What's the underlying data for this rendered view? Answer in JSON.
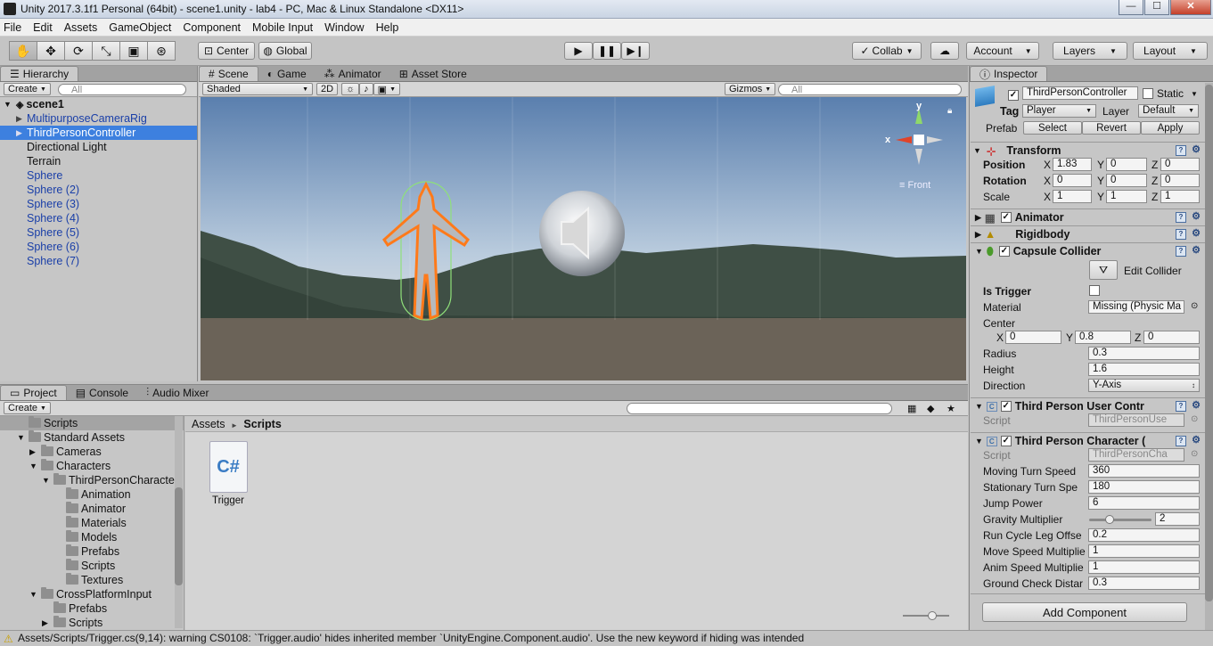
{
  "window": {
    "title": "Unity 2017.3.1f1 Personal (64bit) - scene1.unity - lab4 - PC, Mac & Linux Standalone <DX11>",
    "btn_min": "—",
    "btn_max": "☐",
    "btn_close": "✕"
  },
  "menu": [
    "File",
    "Edit",
    "Assets",
    "GameObject",
    "Component",
    "Mobile Input",
    "Window",
    "Help"
  ],
  "toolbar": {
    "center": "Center",
    "global": "Global",
    "collab": "Collab",
    "account": "Account",
    "layers": "Layers",
    "layout": "Layout"
  },
  "hierarchy": {
    "tab": "Hierarchy",
    "create": "Create",
    "search_placeholder": "All",
    "scene": "scene1",
    "items": [
      "MultipurposeCameraRig",
      "ThirdPersonController",
      "Directional Light",
      "Terrain",
      "Sphere",
      "Sphere (2)",
      "Sphere (3)",
      "Sphere (4)",
      "Sphere (5)",
      "Sphere (6)",
      "Sphere (7)"
    ]
  },
  "scene_view": {
    "tabs": [
      "Scene",
      "Game",
      "Animator",
      "Asset Store"
    ],
    "shading": "Shaded",
    "mode2d": "2D",
    "gizmos": "Gizmos",
    "search_placeholder": "All",
    "axis_y": "y",
    "axis_x": "x",
    "view_label": "Front"
  },
  "project": {
    "tabs": [
      "Project",
      "Console",
      "Audio Mixer"
    ],
    "create": "Create",
    "tree": [
      "Scripts",
      "Standard Assets",
      "Cameras",
      "Characters",
      "ThirdPersonCharacter",
      "Animation",
      "Animator",
      "Materials",
      "Models",
      "Prefabs",
      "Scripts",
      "Textures",
      "CrossPlatformInput",
      "Prefabs",
      "Scripts"
    ],
    "breadcrumb_root": "Assets",
    "breadcrumb_sep": "►",
    "breadcrumb_current": "Scripts",
    "asset_name": "Trigger",
    "asset_icon_text": "C#"
  },
  "inspector": {
    "tab": "Inspector",
    "object_name": "ThirdPersonController",
    "static": "Static",
    "tag_label": "Tag",
    "tag": "Player",
    "layer_label": "Layer",
    "layer": "Default",
    "prefab_label": "Prefab",
    "select": "Select",
    "revert": "Revert",
    "apply": "Apply",
    "transform": {
      "title": "Transform",
      "position": "Position",
      "rotation": "Rotation",
      "scale": "Scale",
      "pos": [
        "1.83",
        "0",
        "0"
      ],
      "rot": [
        "0",
        "0",
        "0"
      ],
      "scl": [
        "1",
        "1",
        "1"
      ],
      "X": "X",
      "Y": "Y",
      "Z": "Z"
    },
    "animator": "Animator",
    "rigidbody": "Rigidbody",
    "capsule": {
      "title": "Capsule Collider",
      "edit": "Edit Collider",
      "is_trigger": "Is Trigger",
      "material_label": "Material",
      "material": "Missing (Physic Ma",
      "center": "Center",
      "cx": "0",
      "cy": "0.8",
      "cz": "0",
      "radius_label": "Radius",
      "radius": "0.3",
      "height_label": "Height",
      "height": "1.6",
      "direction_label": "Direction",
      "direction": "Y-Axis"
    },
    "user_control": {
      "title": "Third Person User Contr",
      "script_label": "Script",
      "script": "ThirdPersonUse"
    },
    "character": {
      "title": "Third Person Character (",
      "script_label": "Script",
      "script": "ThirdPersonCha",
      "rows": [
        {
          "label": "Moving Turn Speed",
          "value": "360"
        },
        {
          "label": "Stationary Turn Spe",
          "value": "180"
        },
        {
          "label": "Jump Power",
          "value": "6"
        },
        {
          "label": "Gravity Multiplier",
          "value": "2"
        },
        {
          "label": "Run Cycle Leg Offse",
          "value": "0.2"
        },
        {
          "label": "Move Speed Multiplie",
          "value": "1"
        },
        {
          "label": "Anim Speed Multiplie",
          "value": "1"
        },
        {
          "label": "Ground Check Distar",
          "value": "0.3"
        }
      ]
    },
    "add_component": "Add Component"
  },
  "status": "Assets/Scripts/Trigger.cs(9,14): warning CS0108: `Trigger.audio' hides inherited member `UnityEngine.Component.audio'. Use the new keyword if hiding was intended",
  "colors": {
    "selection": "#3d80df",
    "sky_top": "#5a7fae",
    "ground": "#6b6358",
    "hill": "#3f4f45",
    "outline": "#ff7a1a"
  }
}
